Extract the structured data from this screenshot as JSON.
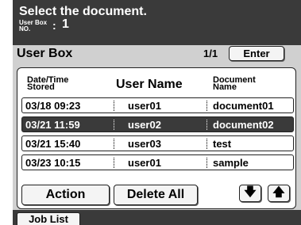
{
  "header": {
    "title": "Select the document.",
    "box_no_label_line1": "User Box",
    "box_no_label_line2": "NO.",
    "box_no_colon": ":",
    "box_no_value": "1"
  },
  "panel": {
    "title": "User Box",
    "page_indicator": "1/1",
    "enter_label": "Enter"
  },
  "columns": {
    "date_line1": "Date/Time",
    "date_line2": "Stored",
    "user": "User Name",
    "doc_line1": "Document",
    "doc_line2": "Name"
  },
  "rows": [
    {
      "date": "03/18 09:23",
      "user": "user01",
      "document": "document01",
      "selected": false
    },
    {
      "date": "03/21 11:59",
      "user": "user02",
      "document": "document02",
      "selected": true
    },
    {
      "date": "03/21 15:40",
      "user": "user03",
      "document": "test",
      "selected": false
    },
    {
      "date": "03/23 10:15",
      "user": "user01",
      "document": "sample",
      "selected": false
    }
  ],
  "buttons": {
    "action": "Action",
    "delete_all": "Delete All",
    "scroll_down_icon": "arrow-down-icon",
    "scroll_up_icon": "arrow-up-icon"
  },
  "footer": {
    "tab_label": "Job List"
  },
  "colors": {
    "dark": "#3a3a3a",
    "panel": "#d0d0d0",
    "selected_row": "#3a3a3a"
  }
}
